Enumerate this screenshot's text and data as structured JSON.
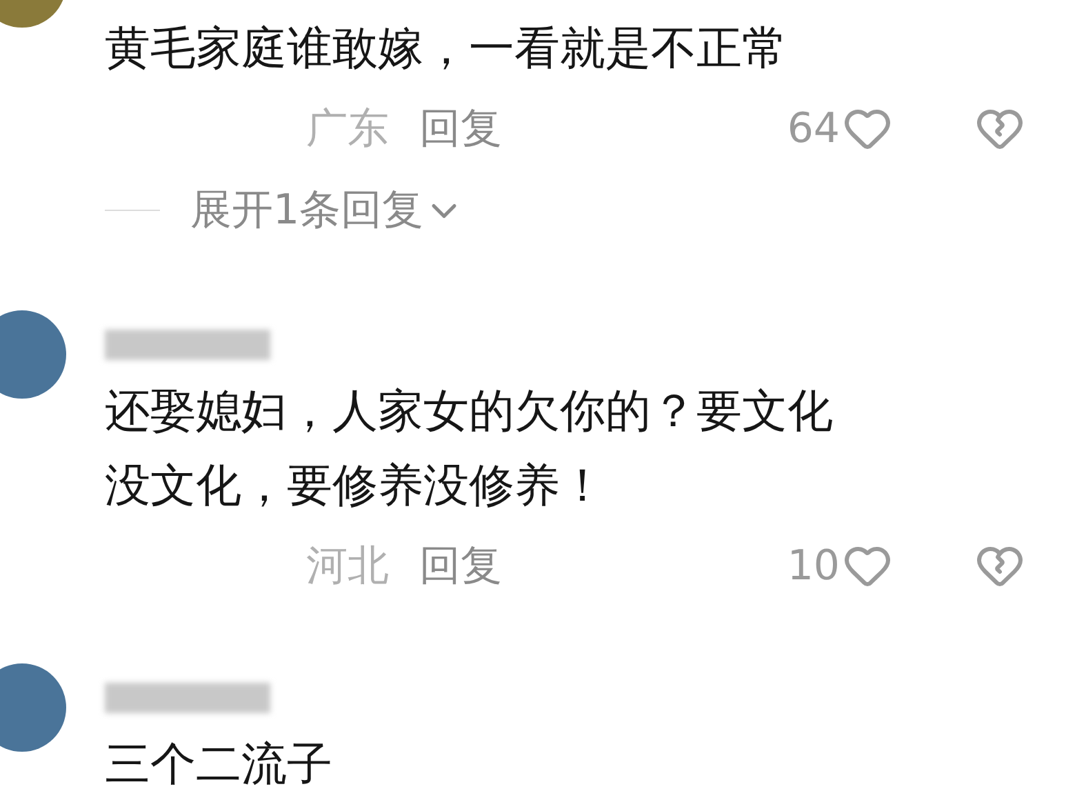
{
  "comments": [
    {
      "username_blurred": false,
      "lines": [
        "黄毛家庭谁敢嫁，一看就是不正常"
      ],
      "location": "广东",
      "reply": "回复",
      "likes": "64",
      "expand": "展开1条回复"
    },
    {
      "username_blurred": true,
      "lines": [
        "还娶媳妇，人家女的欠你的？要文化",
        "没文化，要修养没修养！"
      ],
      "location": "河北",
      "reply": "回复",
      "likes": "10"
    },
    {
      "username_blurred": true,
      "lines": [
        "三个二流子"
      ]
    }
  ]
}
